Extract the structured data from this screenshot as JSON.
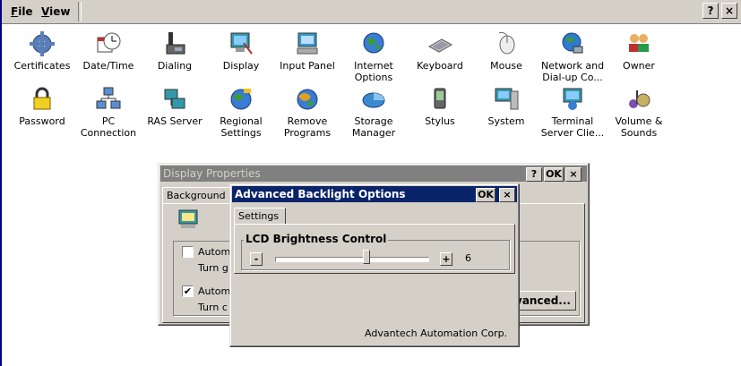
{
  "menu": {
    "file": "File",
    "file_accel": "F",
    "file_rest": "ile",
    "view": "View",
    "view_accel": "V",
    "view_rest": "iew"
  },
  "titlebar_buttons": {
    "help": "?",
    "close": "×"
  },
  "control_panel": {
    "items": [
      {
        "label": "Certificates",
        "icon": "certificates-icon"
      },
      {
        "label": "Date/Time",
        "icon": "clock-icon"
      },
      {
        "label": "Dialing",
        "icon": "phone-icon"
      },
      {
        "label": "Display",
        "icon": "display-icon"
      },
      {
        "label": "Input Panel",
        "icon": "input-panel-icon"
      },
      {
        "label": "Internet Options",
        "icon": "globe-icon"
      },
      {
        "label": "Keyboard",
        "icon": "keyboard-icon"
      },
      {
        "label": "Mouse",
        "icon": "mouse-icon"
      },
      {
        "label": "Network and Dial-up Co...",
        "icon": "network-icon"
      },
      {
        "label": "Owner",
        "icon": "owner-icon"
      },
      {
        "label": "Password",
        "icon": "password-icon"
      },
      {
        "label": "PC Connection",
        "icon": "pc-connection-icon"
      },
      {
        "label": "RAS Server",
        "icon": "ras-server-icon"
      },
      {
        "label": "Regional Settings",
        "icon": "regional-globe-icon"
      },
      {
        "label": "Remove Programs",
        "icon": "remove-programs-icon"
      },
      {
        "label": "Storage Manager",
        "icon": "storage-icon"
      },
      {
        "label": "Stylus",
        "icon": "stylus-icon"
      },
      {
        "label": "System",
        "icon": "system-icon"
      },
      {
        "label": "Terminal Server Clie...",
        "icon": "terminal-server-icon"
      },
      {
        "label": "Volume & Sounds",
        "icon": "volume-icon"
      }
    ]
  },
  "display_properties": {
    "title": "Display Properties",
    "help": "?",
    "ok": "OK",
    "close": "×",
    "tab_background": "Background",
    "check1_label": "Autom",
    "check1_sub": "Turn g",
    "check2_label": "Autom",
    "check2_sub": "Turn c",
    "advanced_button": "vanced..."
  },
  "backlight": {
    "title": "Advanced Backlight Options",
    "ok": "OK",
    "close": "×",
    "tab_settings": "Settings",
    "group_label": "LCD Brightness Control",
    "minus": "-",
    "plus": "+",
    "value": "6",
    "level_fraction": 0.6,
    "footer": "Advantech Automation Corp."
  },
  "colors": {
    "active_title": "#0a246a",
    "inactive_title": "#808080",
    "face": "#d4d0c8"
  }
}
